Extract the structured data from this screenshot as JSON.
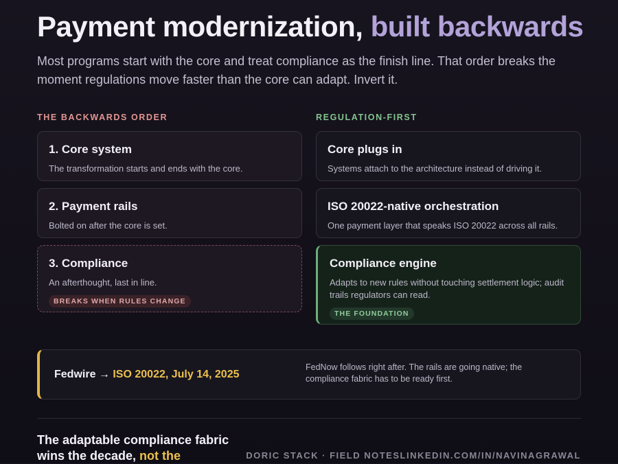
{
  "header": {
    "title_main": "Payment modernization, ",
    "title_accent": "built backwards",
    "subtitle": "Most programs start with the core and treat compliance as the finish line. That order breaks the moment regulations move faster than the core can adapt. Invert it."
  },
  "backwards": {
    "heading": "THE BACKWARDS ORDER",
    "cards": [
      {
        "title": "1. Core system",
        "desc": "The transformation starts and ends with the core."
      },
      {
        "title": "2. Payment rails",
        "desc": "Bolted on after the core is set."
      },
      {
        "title": "3. Compliance",
        "desc": "An afterthought, last in line.",
        "badge": "BREAKS WHEN RULES CHANGE"
      }
    ]
  },
  "regulation_first": {
    "heading": "REGULATION-FIRST",
    "cards": [
      {
        "title": "Core plugs in",
        "desc": "Systems attach to the architecture instead of driving it."
      },
      {
        "title": "ISO 20022-native orchestration",
        "desc": "One payment layer that speaks ISO 20022 across all rails."
      },
      {
        "title": "Compliance engine",
        "desc": "Adapts to new rules without touching settlement logic; audit trails regulators can read.",
        "badge": "THE FOUNDATION"
      }
    ]
  },
  "fedwire": {
    "label": "Fedwire → ",
    "highlight": "ISO 20022, July 14, 2025",
    "note": "FedNow follows right after. The rails are going native; the compliance fabric has to be ready first."
  },
  "closing": {
    "text": "The adaptable compliance fabric wins the decade, ",
    "highlight": "not the"
  },
  "footer": {
    "credit": "DORIC STACK · FIELD NOTESLINKEDIN.COM/IN/NAVINAGRAWAL"
  },
  "colors": {
    "accent_purple": "#b3a3d9",
    "warning_red": "#e39591",
    "success_green": "#83c48f",
    "highlight_yellow": "#ecc04e"
  }
}
